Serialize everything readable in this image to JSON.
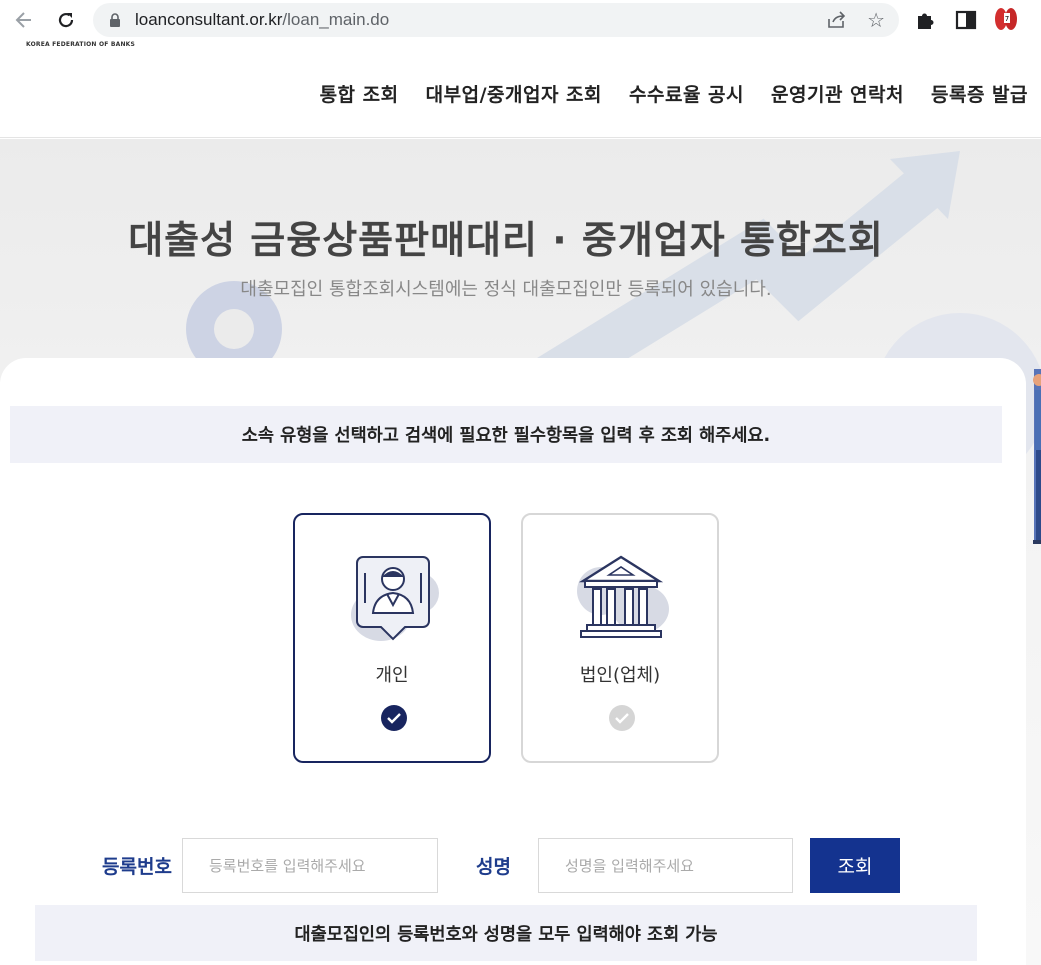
{
  "browser": {
    "url_host": "loanconsultant.or.kr",
    "url_path": "/loan_main.do",
    "icons": [
      "back-arrow-icon",
      "reload-icon",
      "lock-icon",
      "share-icon",
      "star-icon",
      "puzzle-icon",
      "side-panel-icon",
      "profile-icon"
    ]
  },
  "header": {
    "logo_text": "KOREA FEDERATION OF BANKS",
    "nav": [
      {
        "label": "통합 조회"
      },
      {
        "label": "대부업/중개업자 조회"
      },
      {
        "label": "수수료율 공시"
      },
      {
        "label": "운영기관 연락처"
      },
      {
        "label": "등록증 발급"
      }
    ]
  },
  "hero": {
    "title": "대출성 금융상품판매대리 · 중개업자 통합조회",
    "subtitle": "대출모집인 통합조회시스템에는 정식 대출모집인만 등록되어 있습니다."
  },
  "search": {
    "instruction": "소속 유형을 선택하고 검색에 필요한 필수항목을 입력 후 조회 해주세요.",
    "types": [
      {
        "label": "개인",
        "selected": true,
        "icon": "person-icon"
      },
      {
        "label": "법인(업체)",
        "selected": false,
        "icon": "bank-building-icon"
      }
    ],
    "reg_label": "등록번호",
    "reg_placeholder": "등록번호를 입력해주세요",
    "reg_value": "",
    "name_label": "성명",
    "name_placeholder": "성명을 입력해주세요",
    "name_value": "",
    "submit_label": "조회",
    "note": "대출모집인의 등록번호와 성명을 모두 입력해야 조회 가능"
  },
  "colors": {
    "primary": "#14338f",
    "selected_border": "#18255f",
    "label_blue": "#1e3c8c",
    "bar_bg": "#f0f1f8"
  }
}
